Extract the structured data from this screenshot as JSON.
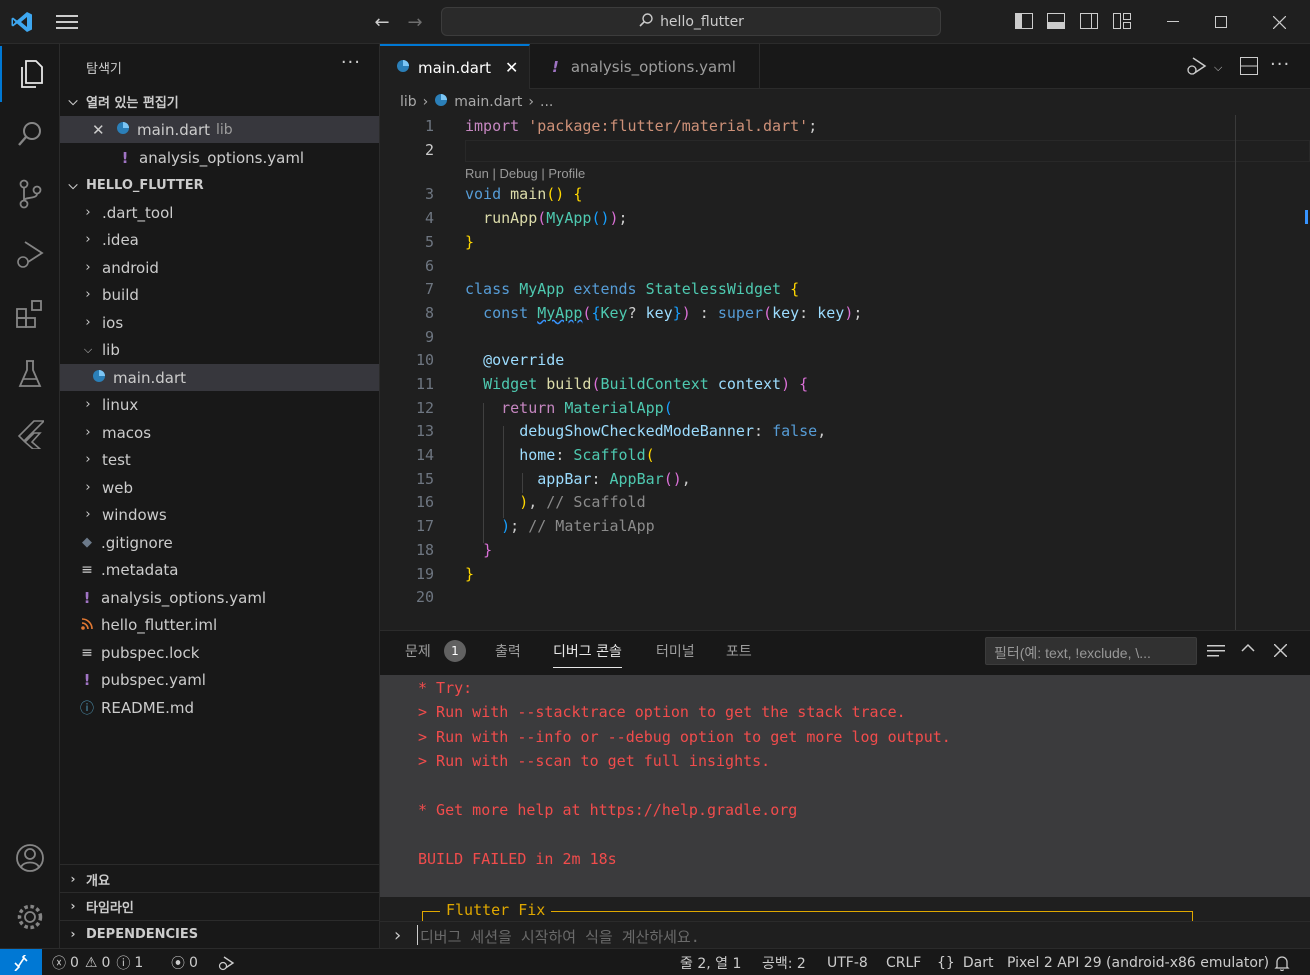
{
  "titlebar": {
    "search_text": "hello_flutter"
  },
  "sidebar": {
    "title": "탐색기",
    "open_editors_label": "열려 있는 편집기",
    "open_editors": [
      {
        "name": "main.dart",
        "desc": "lib"
      },
      {
        "name": "analysis_options.yaml",
        "desc": ""
      }
    ],
    "project_label": "HELLO_FLUTTER",
    "tree": [
      {
        "name": ".dart_tool"
      },
      {
        "name": ".idea"
      },
      {
        "name": "android"
      },
      {
        "name": "build"
      },
      {
        "name": "ios"
      },
      {
        "name": "lib"
      },
      {
        "name": "main.dart"
      },
      {
        "name": "linux"
      },
      {
        "name": "macos"
      },
      {
        "name": "test"
      },
      {
        "name": "web"
      },
      {
        "name": "windows"
      },
      {
        "name": ".gitignore"
      },
      {
        "name": ".metadata"
      },
      {
        "name": "analysis_options.yaml"
      },
      {
        "name": "hello_flutter.iml"
      },
      {
        "name": "pubspec.lock"
      },
      {
        "name": "pubspec.yaml"
      },
      {
        "name": "README.md"
      }
    ],
    "outline_label": "개요",
    "timeline_label": "타임라인",
    "dependencies_label": "DEPENDENCIES"
  },
  "tabs": [
    {
      "label": "main.dart"
    },
    {
      "label": "analysis_options.yaml"
    }
  ],
  "breadcrumb": {
    "folder": "lib",
    "file": "main.dart",
    "more": "..."
  },
  "editor": {
    "codelens": "Run | Debug | Profile",
    "line_numbers": [
      "1",
      "2",
      "3",
      "4",
      "5",
      "6",
      "7",
      "8",
      "9",
      "10",
      "11",
      "12",
      "13",
      "14",
      "15",
      "16",
      "17",
      "18",
      "19",
      "20"
    ],
    "comment_scaffold": "// Scaffold",
    "comment_materialapp": "// MaterialApp"
  },
  "panel": {
    "tabs": [
      "문제",
      "출력",
      "디버그 콘솔",
      "터미널",
      "포트"
    ],
    "problems_count": "1",
    "filter_placeholder": "필터(예: text, !exclude, \\...",
    "console_lines": [
      "* Try:",
      "> Run with --stacktrace option to get the stack trace.",
      "> Run with --info or --debug option to get more log output.",
      "> Run with --scan to get full insights.",
      "",
      "* Get more help at https://help.gradle.org",
      "",
      "BUILD FAILED in 2m 18s"
    ],
    "fix_box_title": "Flutter Fix",
    "repl_placeholder": "디버그 세션을 시작하여 식을 계산하세요."
  },
  "statusbar": {
    "errors": "0",
    "warnings": "0",
    "infos": "1",
    "ports": "0",
    "position": "줄 2, 열 1",
    "spaces": "공백: 2",
    "encoding": "UTF-8",
    "eol": "CRLF",
    "language": "Dart",
    "device": "Pixel 2 API 29 (android-x86 emulator)"
  }
}
